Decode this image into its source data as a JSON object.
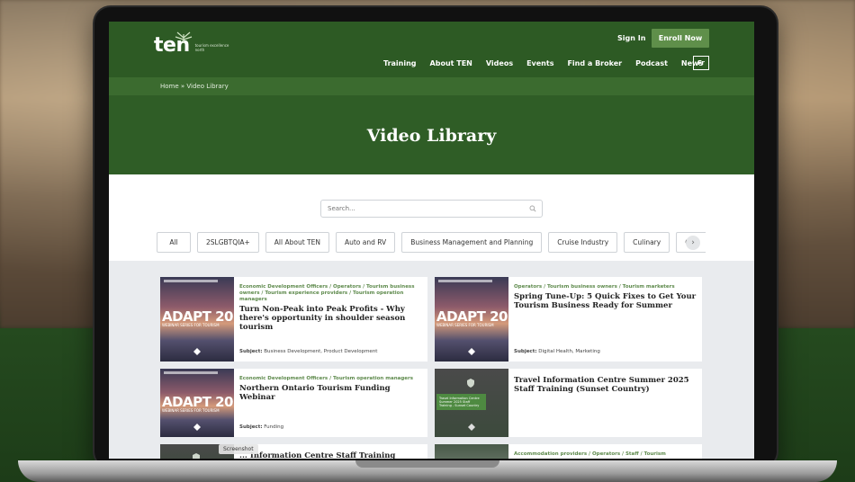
{
  "header": {
    "logo_text": "ten",
    "logo_subtitle": "tourism excellence north",
    "signin_label": "Sign In",
    "enroll_label": "Enroll Now",
    "nav": [
      "Training",
      "About TEN",
      "Videos",
      "Events",
      "Find a Broker",
      "Podcast",
      "News"
    ],
    "lang_label": "Fr",
    "brand_color": "#2d5a24"
  },
  "breadcrumb": "Home » Video Library",
  "hero": {
    "title": "Video Library"
  },
  "search": {
    "placeholder": "Search..."
  },
  "filters": [
    "All",
    "2SLGBTQIA+",
    "All About TEN",
    "Auto and RV",
    "Business Management and Planning",
    "Cruise Industry",
    "Culinary",
    "Cycl"
  ],
  "cards": [
    {
      "tags": "Economic Development Officers / Operators / Tourism business owners / Tourism experience providers / Tourism operation managers",
      "title": "Turn Non-Peak into Peak Profits - Why there's opportunity in shoulder season tourism",
      "subject_label": "Subject:",
      "subject": "Business Development, Product Development",
      "thumb_text": "ADAPT 2025",
      "thumb_sub": "WEBINAR SERIES FOR TOURISM"
    },
    {
      "tags": "Operators / Tourism business owners / Tourism marketers",
      "title": "Spring Tune-Up: 5 Quick Fixes to Get Your Tourism Business Ready for Summer",
      "subject_label": "Subject:",
      "subject": "Digital Health, Marketing",
      "thumb_text": "ADAPT 2025",
      "thumb_sub": "WEBINAR SERIES FOR TOURISM"
    },
    {
      "tags": "Economic Development Officers / Tourism operation managers",
      "title": "Northern Ontario Tourism Funding Webinar",
      "subject_label": "Subject:",
      "subject": "Funding",
      "thumb_text": "ADAPT 2025",
      "thumb_sub": "WEBINAR SERIES FOR TOURISM"
    },
    {
      "tags": "",
      "title": "Travel Information Centre Summer 2025 Staff Training (Sunset Country)",
      "subject_label": "",
      "subject": "",
      "thumb_text": "Travel Information Centre Summer 2025 Staff Training - Sunset Country",
      "thumb_sub": ""
    },
    {
      "tags": "",
      "title": "... Information Centre Staff Training",
      "subject_label": "",
      "subject": "",
      "thumb_text": "",
      "thumb_sub": ""
    },
    {
      "tags": "Accommodation providers / Operators / Staff / Tourism",
      "title": "",
      "subject_label": "",
      "subject": "",
      "thumb_text": "",
      "thumb_sub": ""
    }
  ],
  "tooltip": "Screenshot",
  "chip_arrow": "›"
}
